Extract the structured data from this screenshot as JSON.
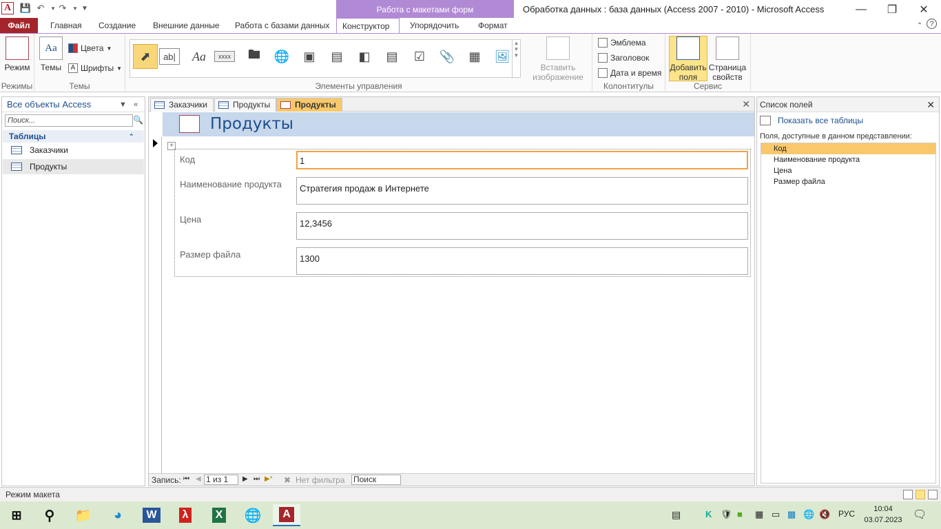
{
  "window": {
    "context_tab_group": "Работа с макетами форм",
    "title": "Обработка данных : база данных (Access 2007 - 2010)  -  Microsoft Access",
    "app_icon": "A"
  },
  "ribbon_tabs": {
    "file": "Файл",
    "home": "Главная",
    "create": "Создание",
    "external": "Внешние данные",
    "database": "Работа с базами данных",
    "design": "Конструктор",
    "arrange": "Упорядочить",
    "format": "Формат"
  },
  "ribbon": {
    "mode_label": "Режим",
    "group_modes": "Режимы",
    "themes_label": "Темы",
    "colors_label": "Цвета",
    "fonts_label": "Шрифты",
    "group_themes": "Темы",
    "group_controls": "Элементы управления",
    "insert_image": "Вставить изображение",
    "logo": "Эмблема",
    "header": "Заголовок",
    "datetime": "Дата и время",
    "group_headers": "Колонтитулы",
    "add_fields": "Добавить поля",
    "property_sheet": "Страница свойств",
    "group_service": "Сервис",
    "ctrl_textbox": "ab|",
    "ctrl_label": "Aa",
    "ctrl_button": "xxxx"
  },
  "nav": {
    "header": "Все объекты Access",
    "search_placeholder": "Поиск...",
    "section": "Таблицы",
    "items": [
      "Заказчики",
      "Продукты"
    ]
  },
  "doc": {
    "tabs": [
      "Заказчики",
      "Продукты",
      "Продукты"
    ],
    "form_title": "Продукты",
    "fields": [
      {
        "label": "Код",
        "value": "1"
      },
      {
        "label": "Наименование продукта",
        "value": "Стратегия продаж в Интернете"
      },
      {
        "label": "Цена",
        "value": "12,3456"
      },
      {
        "label": "Размер файла",
        "value": "1300"
      }
    ],
    "recnav": {
      "label": "Запись:",
      "position": "1 из 1",
      "filter": "Нет фильтра",
      "search": "Поиск"
    }
  },
  "field_list": {
    "title": "Список полей",
    "show_all": "Показать все таблицы",
    "caption": "Поля, доступные в данном представлении:",
    "items": [
      "Код",
      "Наименование продукта",
      "Цена",
      "Размер файла"
    ]
  },
  "status": {
    "text": "Режим макета"
  },
  "taskbar": {
    "lang": "РУС",
    "time": "10:04",
    "date": "03.07.2023"
  },
  "colors": {
    "file_tab": "#a4262c",
    "context": "#b18ad5",
    "selection": "#f8c86b",
    "focus": "#f2a241"
  }
}
